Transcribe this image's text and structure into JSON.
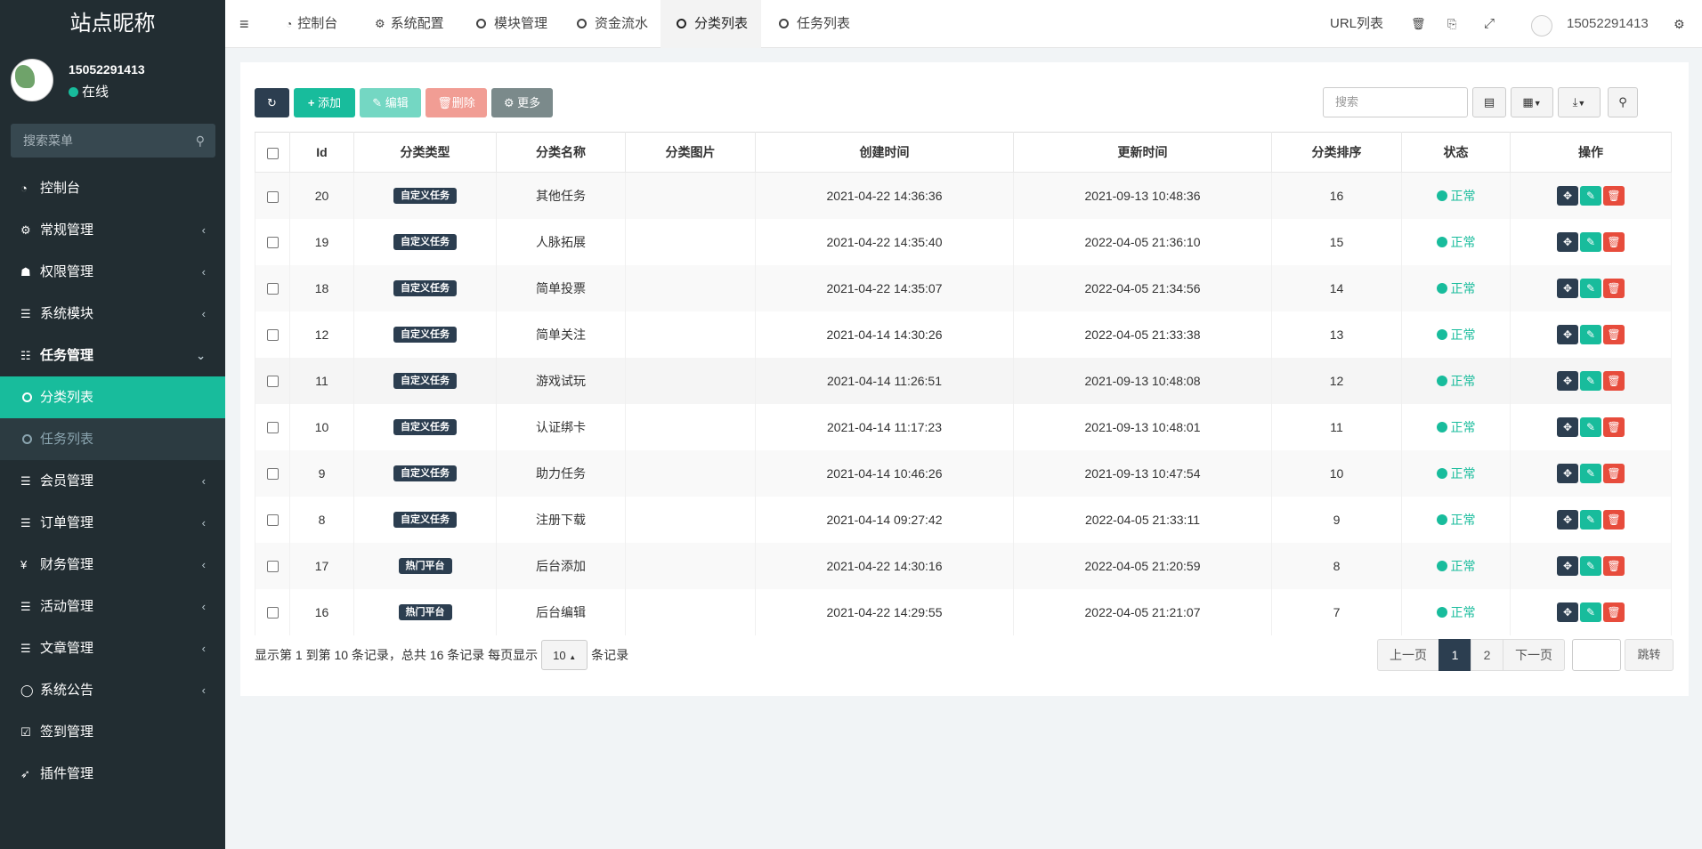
{
  "app": {
    "title": "站点昵称"
  },
  "user": {
    "name": "15052291413",
    "status": "在线"
  },
  "sidebar": {
    "search_placeholder": "搜索菜单",
    "items": [
      {
        "label": "控制台",
        "icon": "dashboard-icon"
      },
      {
        "label": "常规管理",
        "icon": "cogs-icon"
      },
      {
        "label": "权限管理",
        "icon": "group-icon"
      },
      {
        "label": "系统模块",
        "icon": "list-icon"
      },
      {
        "label": "任务管理",
        "icon": "table-icon"
      },
      {
        "label": "分类列表",
        "icon": "circle-icon"
      },
      {
        "label": "任务列表",
        "icon": "circle-icon"
      },
      {
        "label": "会员管理",
        "icon": "list-icon"
      },
      {
        "label": "订单管理",
        "icon": "list-icon"
      },
      {
        "label": "财务管理",
        "icon": "yen-icon"
      },
      {
        "label": "活动管理",
        "icon": "list-icon"
      },
      {
        "label": "文章管理",
        "icon": "list-icon"
      },
      {
        "label": "系统公告",
        "icon": "comment-icon"
      },
      {
        "label": "签到管理",
        "icon": "calendar-check-icon"
      },
      {
        "label": "插件管理",
        "icon": "rocket-icon"
      }
    ]
  },
  "topbar": {
    "tabs": [
      {
        "label": "控制台"
      },
      {
        "label": "系统配置"
      },
      {
        "label": "模块管理"
      },
      {
        "label": "资金流水"
      },
      {
        "label": "分类列表"
      },
      {
        "label": "任务列表"
      }
    ],
    "url_list": "URL列表",
    "user_name": "15052291413"
  },
  "toolbar": {
    "add": "添加",
    "edit": "编辑",
    "delete": "删除",
    "more": "更多",
    "search_placeholder": "搜索"
  },
  "table": {
    "headers": [
      "Id",
      "分类类型",
      "分类名称",
      "分类图片",
      "创建时间",
      "更新时间",
      "分类排序",
      "状态",
      "操作"
    ],
    "rows": [
      {
        "id": "20",
        "type": "自定义任务",
        "name": "其他任务",
        "created": "2021-04-22 14:36:36",
        "updated": "2021-09-13 10:48:36",
        "sort": "16",
        "status": "正常"
      },
      {
        "id": "19",
        "type": "自定义任务",
        "name": "人脉拓展",
        "created": "2021-04-22 14:35:40",
        "updated": "2022-04-05 21:36:10",
        "sort": "15",
        "status": "正常"
      },
      {
        "id": "18",
        "type": "自定义任务",
        "name": "简单投票",
        "created": "2021-04-22 14:35:07",
        "updated": "2022-04-05 21:34:56",
        "sort": "14",
        "status": "正常"
      },
      {
        "id": "12",
        "type": "自定义任务",
        "name": "简单关注",
        "created": "2021-04-14 14:30:26",
        "updated": "2022-04-05 21:33:38",
        "sort": "13",
        "status": "正常"
      },
      {
        "id": "11",
        "type": "自定义任务",
        "name": "游戏试玩",
        "created": "2021-04-14 11:26:51",
        "updated": "2021-09-13 10:48:08",
        "sort": "12",
        "status": "正常"
      },
      {
        "id": "10",
        "type": "自定义任务",
        "name": "认证绑卡",
        "created": "2021-04-14 11:17:23",
        "updated": "2021-09-13 10:48:01",
        "sort": "11",
        "status": "正常"
      },
      {
        "id": "9",
        "type": "自定义任务",
        "name": "助力任务",
        "created": "2021-04-14 10:46:26",
        "updated": "2021-09-13 10:47:54",
        "sort": "10",
        "status": "正常"
      },
      {
        "id": "8",
        "type": "自定义任务",
        "name": "注册下载",
        "created": "2021-04-14 09:27:42",
        "updated": "2022-04-05 21:33:11",
        "sort": "9",
        "status": "正常"
      },
      {
        "id": "17",
        "type": "热门平台",
        "name": "后台添加",
        "created": "2021-04-22 14:30:16",
        "updated": "2022-04-05 21:20:59",
        "sort": "8",
        "status": "正常"
      },
      {
        "id": "16",
        "type": "热门平台",
        "name": "后台编辑",
        "created": "2021-04-22 14:29:55",
        "updated": "2022-04-05 21:21:07",
        "sort": "7",
        "status": "正常"
      }
    ]
  },
  "pagination": {
    "info_prefix": "显示第 1 到第 10 条记录，总共 16 条记录 每页显示",
    "page_size": "10",
    "info_suffix": "条记录",
    "prev": "上一页",
    "pages": [
      "1",
      "2"
    ],
    "next": "下一页",
    "jump": "跳转"
  },
  "colors": {
    "accent": "#18bc9c",
    "dark": "#2c3e50",
    "danger": "#e74c3c",
    "sidebar": "#222d32"
  }
}
